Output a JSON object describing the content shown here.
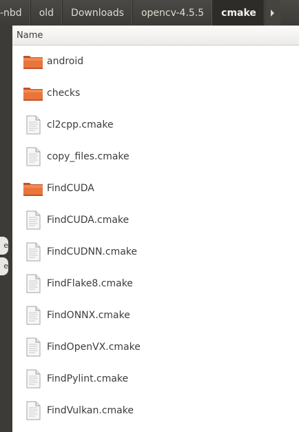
{
  "breadcrumb": {
    "items": [
      "-nbd",
      "old",
      "Downloads",
      "opencv-4.5.5",
      "cmake"
    ],
    "active_index": 4,
    "next_icon": "triangle-right-icon"
  },
  "list": {
    "column_header": "Name",
    "rows": [
      {
        "name": "android",
        "type": "folder"
      },
      {
        "name": "checks",
        "type": "folder"
      },
      {
        "name": "cl2cpp.cmake",
        "type": "file"
      },
      {
        "name": "copy_files.cmake",
        "type": "file"
      },
      {
        "name": "FindCUDA",
        "type": "folder"
      },
      {
        "name": "FindCUDA.cmake",
        "type": "file"
      },
      {
        "name": "FindCUDNN.cmake",
        "type": "file"
      },
      {
        "name": "FindFlake8.cmake",
        "type": "file"
      },
      {
        "name": "FindONNX.cmake",
        "type": "file"
      },
      {
        "name": "FindOpenVX.cmake",
        "type": "file"
      },
      {
        "name": "FindPylint.cmake",
        "type": "file"
      },
      {
        "name": "FindVulkan.cmake",
        "type": "file"
      }
    ]
  },
  "side_tabs": [
    {
      "label": "e"
    },
    {
      "label": "e"
    }
  ],
  "colors": {
    "folder_orange": "#e9753c",
    "active_crumb": "#2d2c28"
  }
}
